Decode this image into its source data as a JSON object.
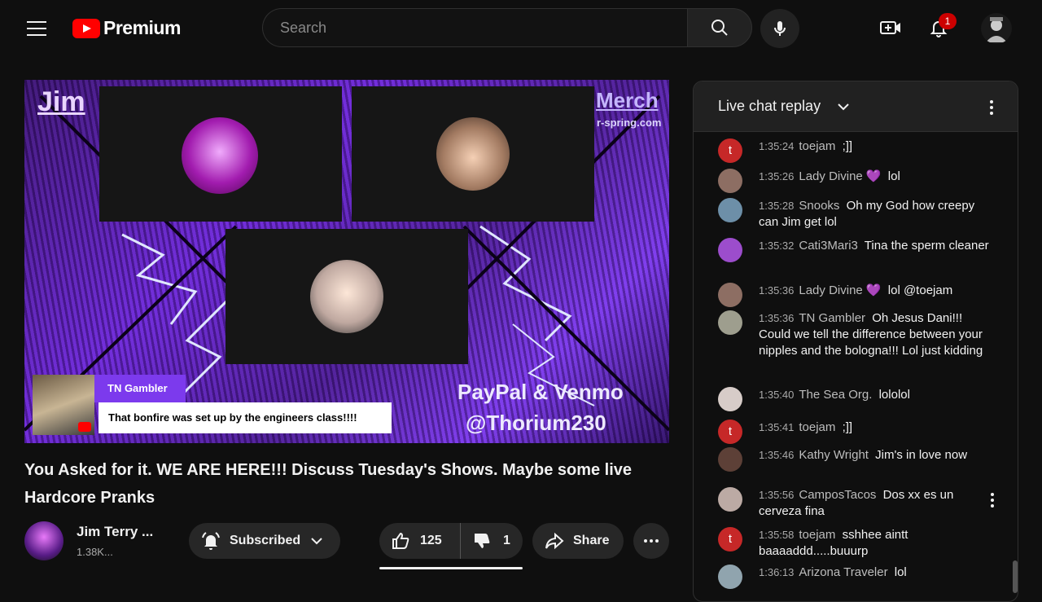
{
  "header": {
    "logo_text": "Premium",
    "search_placeholder": "Search",
    "notification_count": "1"
  },
  "video_overlay": {
    "jim": "Jim",
    "merch": "Merch",
    "merch_url": "r-spring.com",
    "paypal": "PayPal & Venmo",
    "handle": "@Thorium230",
    "comment_author": "TN Gambler",
    "comment_text": "That bonfire was set up by the engineers class!!!!"
  },
  "video": {
    "title": "You Asked for it. WE ARE HERE!!! Discuss Tuesday's Shows. Maybe some live Hardcore Pranks",
    "channel_name": "Jim Terry ...",
    "subscribers": "1.38K...",
    "subscribed_label": "Subscribed",
    "likes": "125",
    "dislikes": "1",
    "share_label": "Share"
  },
  "chat": {
    "title": "Live chat replay",
    "messages": [
      {
        "time": "1:35:24",
        "author": "toejam",
        "text": ";]]",
        "avatar_color": "#c62828",
        "avatar_letter": "t"
      },
      {
        "time": "1:35:26",
        "author": "Lady Divine 💜",
        "text": "lol",
        "avatar_color": "#8d6e63",
        "avatar_letter": ""
      },
      {
        "time": "1:35:28",
        "author": "Snooks",
        "text": "Oh my God how creepy can Jim get lol",
        "avatar_color": "#6d8fa8",
        "avatar_letter": ""
      },
      {
        "time": "1:35:32",
        "author": "Cati3Mari3",
        "text": "Tina the sperm cleaner",
        "avatar_color": "#9c4dcc",
        "avatar_letter": ""
      },
      {
        "time": "1:35:36",
        "author": "Lady Divine 💜",
        "text": "lol @toejam",
        "avatar_color": "#8d6e63",
        "avatar_letter": ""
      },
      {
        "time": "1:35:36",
        "author": "TN Gambler",
        "text": "Oh Jesus Dani!!! Could we tell the difference between your nipples and the bologna!!! Lol just kidding",
        "avatar_color": "#9e9e8e",
        "avatar_letter": ""
      },
      {
        "time": "1:35:40",
        "author": "The Sea Org.",
        "text": "lololol",
        "avatar_color": "#d7ccc8",
        "avatar_letter": ""
      },
      {
        "time": "1:35:41",
        "author": "toejam",
        "text": ";]]",
        "avatar_color": "#c62828",
        "avatar_letter": "t"
      },
      {
        "time": "1:35:46",
        "author": "Kathy Wright",
        "text": "Jim's in love now",
        "avatar_color": "#5d4037",
        "avatar_letter": ""
      },
      {
        "time": "1:35:56",
        "author": "CamposTacos",
        "text": "Dos xx es un cerveza fina",
        "avatar_color": "#bcaaa4",
        "avatar_letter": ""
      },
      {
        "time": "1:35:58",
        "author": "toejam",
        "text": "sshhee aintt baaaaddd.....buuurp",
        "avatar_color": "#c62828",
        "avatar_letter": "t"
      },
      {
        "time": "1:36:13",
        "author": "Arizona Traveler",
        "text": "lol",
        "avatar_color": "#90a4ae",
        "avatar_letter": ""
      }
    ]
  }
}
